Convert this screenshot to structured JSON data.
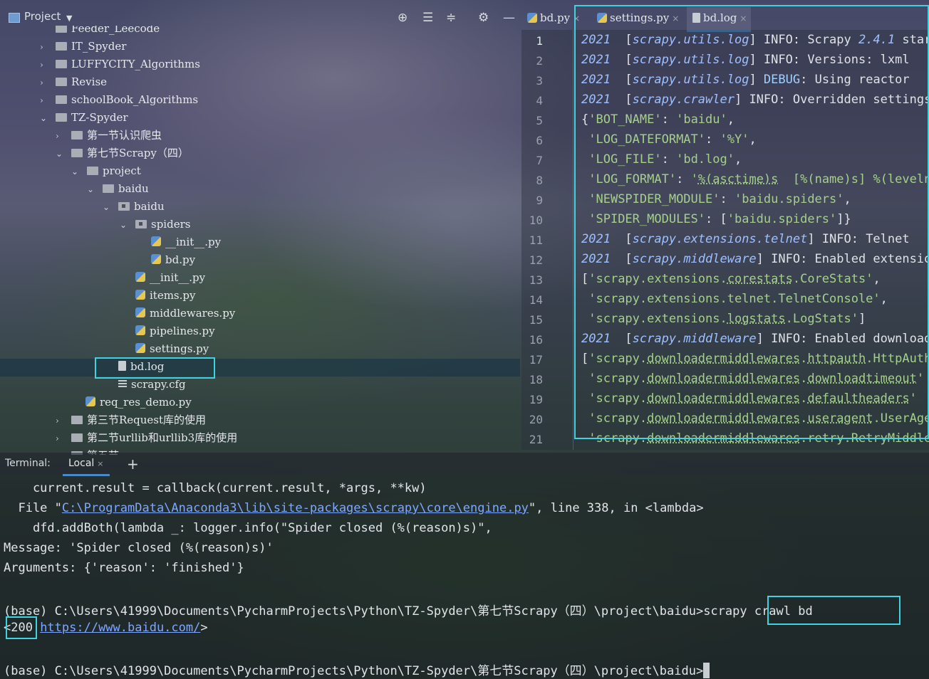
{
  "project": {
    "title": "Project",
    "tree": [
      {
        "label": "Feeder_Leecode",
        "type": "folder",
        "arrow": "",
        "cut": true
      },
      {
        "label": "IT_Spyder",
        "type": "folder",
        "arrow": "›"
      },
      {
        "label": "LUFFYCITY_Algorithms",
        "type": "folder",
        "arrow": "›"
      },
      {
        "label": "Revise",
        "type": "folder",
        "arrow": "›"
      },
      {
        "label": "schoolBook_Algorithms",
        "type": "folder",
        "arrow": "›"
      },
      {
        "label": "TZ-Spyder",
        "type": "folder",
        "arrow": "⌄"
      },
      {
        "label": "第一节认识爬虫",
        "type": "folder",
        "arrow": "›"
      },
      {
        "label": "第七节Scrapy（四）",
        "type": "folder",
        "arrow": "⌄"
      },
      {
        "label": "project",
        "type": "folder",
        "arrow": "⌄"
      },
      {
        "label": "baidu",
        "type": "folder",
        "arrow": "⌄"
      },
      {
        "label": "baidu",
        "type": "pkg",
        "arrow": "⌄"
      },
      {
        "label": "spiders",
        "type": "pkg",
        "arrow": "⌄"
      },
      {
        "label": "__init__.py",
        "type": "py",
        "arrow": ""
      },
      {
        "label": "bd.py",
        "type": "py",
        "arrow": ""
      },
      {
        "label": "__init__.py",
        "type": "py",
        "arrow": ""
      },
      {
        "label": "items.py",
        "type": "py",
        "arrow": ""
      },
      {
        "label": "middlewares.py",
        "type": "py",
        "arrow": ""
      },
      {
        "label": "pipelines.py",
        "type": "py",
        "arrow": ""
      },
      {
        "label": "settings.py",
        "type": "py",
        "arrow": ""
      },
      {
        "label": "bd.log",
        "type": "log",
        "arrow": ""
      },
      {
        "label": "scrapy.cfg",
        "type": "cfg",
        "arrow": ""
      },
      {
        "label": "req_res_demo.py",
        "type": "py",
        "arrow": ""
      },
      {
        "label": "第三节Request库的使用",
        "type": "folder",
        "arrow": "›"
      },
      {
        "label": "第二节urllib和urllib3库的使用",
        "type": "folder",
        "arrow": "›"
      },
      {
        "label": "第五节",
        "type": "folder",
        "arrow": "›",
        "cut": true
      }
    ]
  },
  "editor": {
    "tabs": [
      {
        "label": "bd.py",
        "close": "×"
      },
      {
        "label": "settings.py",
        "close": "×"
      },
      {
        "label": "bd.log",
        "close": "×",
        "active": true
      }
    ],
    "line_numbers": [
      "1",
      "2",
      "3",
      "4",
      "5",
      "6",
      "7",
      "8",
      "9",
      "10",
      "11",
      "12",
      "13",
      "14",
      "15",
      "16",
      "17",
      "18",
      "19",
      "20",
      "21"
    ]
  },
  "terminal": {
    "label": "Terminal:",
    "tab": "Local",
    "add": "+",
    "lines": [
      "    current.result = callback(current.result, *args, **kw)",
      "  File \"",
      "    dfd.addBoth(lambda _: logger.info(\"Spider closed (%(reason)s)\",",
      "Message: 'Spider closed (%(reason)s)'",
      "Arguments: {'reason': 'finished'}",
      "",
      "(base) C:\\Users\\41999\\Documents\\PycharmProjects\\Python\\TZ-Spyder\\第七节Scrapy（四）\\project\\baidu>scrapy crawl bd",
      "",
      "",
      "(base) C:\\Users\\41999\\Documents\\PycharmProjects\\Python\\TZ-Spyder\\第七节Scrapy（四）\\project\\baidu>"
    ],
    "file_link": "C:\\ProgramData\\Anaconda3\\lib\\site-packages\\scrapy\\core\\engine.py",
    "file_suffix": "\", line 338, in <lambda>",
    "response_prefix": "<200 ",
    "response_url": "https://www.baidu.com/",
    "response_suffix": ">"
  }
}
